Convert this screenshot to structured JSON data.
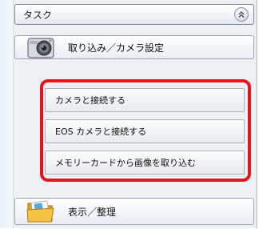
{
  "panel": {
    "title": "タスク",
    "collapse_icon": "chevrons-up-icon"
  },
  "groups": [
    {
      "label": "取り込み／カメラ設定",
      "icon": "camera-icon",
      "items": [
        {
          "label": "カメラと接続する"
        },
        {
          "label": "EOS カメラと接続する"
        },
        {
          "label": "メモリーカードから画像を取り込む"
        }
      ]
    },
    {
      "label": "表示／整理",
      "icon": "folder-icon",
      "items": []
    }
  ],
  "colors": {
    "highlight": "#e3151f",
    "pane_background": "#eef1f4"
  }
}
